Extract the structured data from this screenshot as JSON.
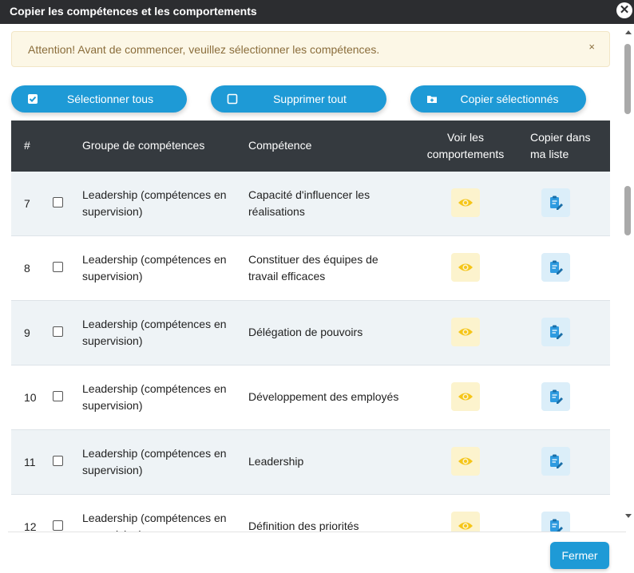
{
  "dialog": {
    "title": "Copier les compétences et les comportements",
    "close_icon": "close-icon"
  },
  "alert": {
    "message": "Attention! Avant de commencer, veuillez sélectionner les compétences.",
    "dismiss": "×"
  },
  "actions": {
    "select_all": "Sélectionner tous",
    "delete_all": "Supprimer tout",
    "copy_selected": "Copier sélectionnés"
  },
  "table": {
    "headers": {
      "num": "#",
      "group": "Groupe de compétences",
      "competence": "Compétence",
      "view_1": "Voir les",
      "view_2": "comportements",
      "copy_1": "Copier dans",
      "copy_2": "ma liste"
    },
    "rows": [
      {
        "num": "7",
        "group_1": "Leadership (compétences en",
        "group_2": "supervision)",
        "comp_1": "Capacité d'influencer les",
        "comp_2": "réalisations"
      },
      {
        "num": "8",
        "group_1": "Leadership (compétences en",
        "group_2": "supervision)",
        "comp_1": "Constituer des équipes de",
        "comp_2": "travail efficaces"
      },
      {
        "num": "9",
        "group_1": "Leadership (compétences en",
        "group_2": "supervision)",
        "comp_1": "Délégation de pouvoirs",
        "comp_2": ""
      },
      {
        "num": "10",
        "group_1": "Leadership (compétences en",
        "group_2": "supervision)",
        "comp_1": "Développement des employés",
        "comp_2": ""
      },
      {
        "num": "11",
        "group_1": "Leadership (compétences en",
        "group_2": "supervision)",
        "comp_1": "Leadership",
        "comp_2": ""
      },
      {
        "num": "12",
        "group_1": "Leadership (compétences en",
        "group_2": "supervision)",
        "comp_1": "Définition des priorités",
        "comp_2": ""
      }
    ]
  },
  "footer": {
    "close_label": "Fermer"
  },
  "colors": {
    "primary": "#1e9ad6",
    "header_bg": "#353a3f",
    "eye_bg": "#fcf3cd",
    "eye_icon": "#f5c518",
    "copy_bg": "#dbeef9",
    "copy_icon": "#2e9be0"
  }
}
